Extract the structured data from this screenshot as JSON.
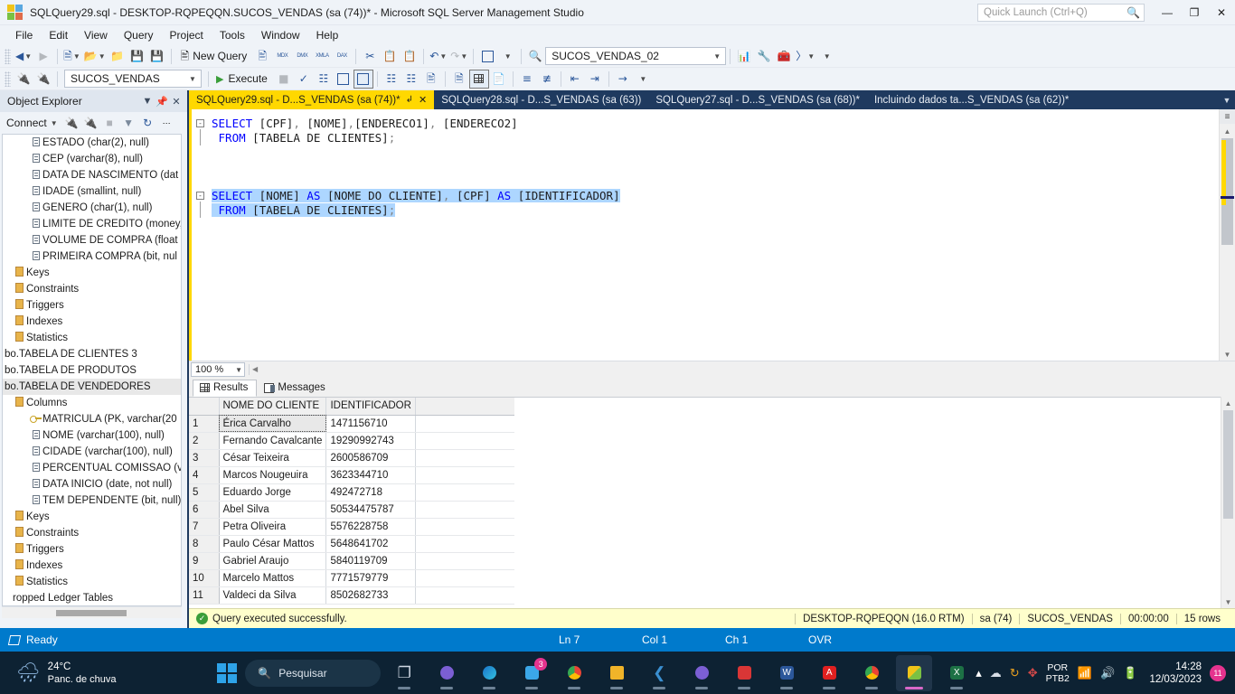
{
  "titlebar": {
    "title": "SQLQuery29.sql - DESKTOP-RQPEQQN.SUCOS_VENDAS (sa (74))* - Microsoft SQL Server Management Studio",
    "quick_launch_placeholder": "Quick Launch (Ctrl+Q)",
    "minimize": "—",
    "restore": "❐",
    "close": "✕"
  },
  "menu": [
    "File",
    "Edit",
    "View",
    "Query",
    "Project",
    "Tools",
    "Window",
    "Help"
  ],
  "toolbar1": {
    "nav_back": "◀",
    "nav_forward": "▶",
    "new_query_label": "New Query",
    "db_mdx": "MDX",
    "db_dmx": "DMX",
    "db_xmla": "XMLA",
    "db_dax": "DAX",
    "database_combo": "SUCOS_VENDAS_02"
  },
  "toolbar2": {
    "database_combo": "SUCOS_VENDAS",
    "execute_label": "Execute"
  },
  "object_explorer": {
    "title": "Object Explorer",
    "connect_label": "Connect",
    "nodes": [
      {
        "label": "ESTADO (char(2), null)",
        "icon": "column-icon",
        "indent": 3,
        "selected": false
      },
      {
        "label": "CEP (varchar(8), null)",
        "icon": "column-icon",
        "indent": 3,
        "selected": false
      },
      {
        "label": "DATA DE NASCIMENTO (dat",
        "icon": "column-icon",
        "indent": 3,
        "selected": false
      },
      {
        "label": "IDADE (smallint, null)",
        "icon": "column-icon",
        "indent": 3,
        "selected": false
      },
      {
        "label": "GENERO (char(1), null)",
        "icon": "column-icon",
        "indent": 3,
        "selected": false
      },
      {
        "label": "LIMITE DE CREDITO (money,",
        "icon": "column-icon",
        "indent": 3,
        "selected": false
      },
      {
        "label": "VOLUME DE COMPRA (float",
        "icon": "column-icon",
        "indent": 3,
        "selected": false
      },
      {
        "label": "PRIMEIRA COMPRA (bit, nul",
        "icon": "column-icon",
        "indent": 3,
        "selected": false
      },
      {
        "label": "Keys",
        "icon": "folder-icon",
        "indent": 1,
        "selected": false
      },
      {
        "label": "Constraints",
        "icon": "folder-icon",
        "indent": 1,
        "selected": false
      },
      {
        "label": "Triggers",
        "icon": "folder-icon",
        "indent": 1,
        "selected": false
      },
      {
        "label": "Indexes",
        "icon": "folder-icon",
        "indent": 1,
        "selected": false
      },
      {
        "label": "Statistics",
        "icon": "folder-icon",
        "indent": 1,
        "selected": false
      },
      {
        "label": "bo.TABELA DE CLIENTES 3",
        "icon": "none",
        "indent": 0,
        "selected": false
      },
      {
        "label": "bo.TABELA DE PRODUTOS",
        "icon": "none",
        "indent": 0,
        "selected": false
      },
      {
        "label": "bo.TABELA DE VENDEDORES",
        "icon": "none",
        "indent": 0,
        "selected": true
      },
      {
        "label": "Columns",
        "icon": "folder-icon",
        "indent": 1,
        "selected": false
      },
      {
        "label": "MATRICULA (PK, varchar(20",
        "icon": "key-icon",
        "indent": 3,
        "selected": false
      },
      {
        "label": "NOME (varchar(100), null)",
        "icon": "column-icon",
        "indent": 3,
        "selected": false
      },
      {
        "label": "CIDADE (varchar(100), null)",
        "icon": "column-icon",
        "indent": 3,
        "selected": false
      },
      {
        "label": "PERCENTUAL COMISSAO (v",
        "icon": "column-icon",
        "indent": 3,
        "selected": false
      },
      {
        "label": "DATA INICIO (date, not null)",
        "icon": "column-icon",
        "indent": 3,
        "selected": false
      },
      {
        "label": "TEM DEPENDENTE (bit, null)",
        "icon": "column-icon",
        "indent": 3,
        "selected": false
      },
      {
        "label": "Keys",
        "icon": "folder-icon",
        "indent": 1,
        "selected": false
      },
      {
        "label": "Constraints",
        "icon": "folder-icon",
        "indent": 1,
        "selected": false
      },
      {
        "label": "Triggers",
        "icon": "folder-icon",
        "indent": 1,
        "selected": false
      },
      {
        "label": "Indexes",
        "icon": "folder-icon",
        "indent": 1,
        "selected": false
      },
      {
        "label": "Statistics",
        "icon": "folder-icon",
        "indent": 1,
        "selected": false
      },
      {
        "label": "ropped Ledger Tables",
        "icon": "none",
        "indent": 1,
        "selected": false
      }
    ]
  },
  "tabs": [
    {
      "label": "SQLQuery29.sql - D...S_VENDAS (sa (74))*",
      "active": true
    },
    {
      "label": "SQLQuery28.sql - D...S_VENDAS (sa (63))",
      "active": false
    },
    {
      "label": "SQLQuery27.sql - D...S_VENDAS (sa (68))*",
      "active": false
    },
    {
      "label": "Incluindo dados ta...S_VENDAS (sa (62))*",
      "active": false
    }
  ],
  "editor": {
    "lines": [
      {
        "n": 1,
        "segs": [
          {
            "t": "SELECT",
            "c": "kw"
          },
          {
            "t": " [CPF]",
            "c": ""
          },
          {
            "t": ",",
            "c": "punc"
          },
          {
            "t": " [NOME]",
            "c": ""
          },
          {
            "t": ",",
            "c": "punc"
          },
          {
            "t": "[ENDERECO1]",
            "c": ""
          },
          {
            "t": ",",
            "c": "punc"
          },
          {
            "t": " [ENDERECO2]",
            "c": ""
          }
        ],
        "highlight": false,
        "fold": true
      },
      {
        "n": 2,
        "segs": [
          {
            "t": " ",
            "c": ""
          },
          {
            "t": "FROM",
            "c": "kw"
          },
          {
            "t": " [TABELA DE CLIENTES]",
            "c": ""
          },
          {
            "t": ";",
            "c": "punc"
          }
        ],
        "highlight": false,
        "fold": false
      },
      {
        "n": 3,
        "segs": [],
        "highlight": false,
        "fold": false
      },
      {
        "n": 4,
        "segs": [],
        "highlight": false,
        "fold": false
      },
      {
        "n": 5,
        "segs": [],
        "highlight": false,
        "fold": false
      },
      {
        "n": 6,
        "segs": [
          {
            "t": "SELECT",
            "c": "kw"
          },
          {
            "t": " [NOME] ",
            "c": ""
          },
          {
            "t": "AS",
            "c": "kw"
          },
          {
            "t": " [NOME DO CLIENTE]",
            "c": ""
          },
          {
            "t": ",",
            "c": "punc"
          },
          {
            "t": " [CPF] ",
            "c": ""
          },
          {
            "t": "AS",
            "c": "kw"
          },
          {
            "t": " [IDENTIFICADOR]",
            "c": ""
          }
        ],
        "highlight": true,
        "fold": true
      },
      {
        "n": 7,
        "segs": [
          {
            "t": " ",
            "c": ""
          },
          {
            "t": "FROM",
            "c": "kw"
          },
          {
            "t": " [TABELA DE CLIENTES]",
            "c": ""
          },
          {
            "t": ";",
            "c": "punc"
          }
        ],
        "highlight": true,
        "fold": false
      }
    ],
    "zoom": "100 %"
  },
  "results": {
    "tabs": [
      {
        "label": "Results",
        "icon": "grid-icon",
        "active": true
      },
      {
        "label": "Messages",
        "icon": "messages-icon",
        "active": false
      }
    ],
    "columns": [
      "",
      "NOME DO CLIENTE",
      "IDENTIFICADOR"
    ],
    "rows": [
      {
        "n": "1",
        "nome": "Érica Carvalho",
        "id": "1471156710"
      },
      {
        "n": "2",
        "nome": "Fernando Cavalcante",
        "id": "19290992743"
      },
      {
        "n": "3",
        "nome": "César Teixeira",
        "id": "2600586709"
      },
      {
        "n": "4",
        "nome": "Marcos Nougeuira",
        "id": "3623344710"
      },
      {
        "n": "5",
        "nome": "Eduardo Jorge",
        "id": "492472718"
      },
      {
        "n": "6",
        "nome": "Abel Silva",
        "id": "50534475787"
      },
      {
        "n": "7",
        "nome": "Petra Oliveira",
        "id": "5576228758"
      },
      {
        "n": "8",
        "nome": "Paulo César Mattos",
        "id": "5648641702"
      },
      {
        "n": "9",
        "nome": "Gabriel Araujo",
        "id": "5840119709"
      },
      {
        "n": "10",
        "nome": "Marcelo Mattos",
        "id": "7771579779"
      },
      {
        "n": "11",
        "nome": "Valdeci da Silva",
        "id": "8502682733"
      }
    ]
  },
  "query_status": {
    "message": "Query executed successfully.",
    "server": "DESKTOP-RQPEQQN (16.0 RTM)",
    "user": "sa (74)",
    "database": "SUCOS_VENDAS",
    "elapsed": "00:00:00",
    "rows": "15 rows"
  },
  "vs_status": {
    "ready": "Ready",
    "line": "Ln 7",
    "col": "Col 1",
    "ch": "Ch 1",
    "ovr": "OVR"
  },
  "taskbar": {
    "weather_temp": "24°C",
    "weather_desc": "Panc. de chuva",
    "search_placeholder": "Pesquisar",
    "mail_badge": "3",
    "language_1": "POR",
    "language_2": "PTB2",
    "time": "14:28",
    "date": "12/03/2023",
    "notification_count": "11"
  },
  "colors": {
    "accent": "#007acc",
    "active_tab": "#ffd800",
    "status_bar": "#ffffcc",
    "keyword": "#0000ff",
    "selection": "#add6ff",
    "taskbar": "#0d2233"
  }
}
